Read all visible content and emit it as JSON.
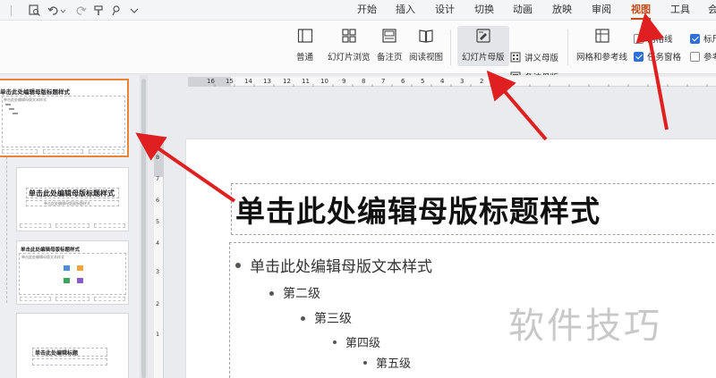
{
  "tabs": [
    {
      "label": "开始",
      "active": false
    },
    {
      "label": "插入",
      "active": false
    },
    {
      "label": "设计",
      "active": false
    },
    {
      "label": "切换",
      "active": false
    },
    {
      "label": "动画",
      "active": false
    },
    {
      "label": "放映",
      "active": false
    },
    {
      "label": "审阅",
      "active": false
    },
    {
      "label": "视图",
      "active": true
    },
    {
      "label": "工具",
      "active": false
    },
    {
      "label": "会",
      "active": false
    }
  ],
  "ribbon": {
    "normal": "普通",
    "slide_sorter": "幻灯片浏览",
    "notes_page": "备注页",
    "reading_view": "阅读视图",
    "slide_master": "幻灯片母版",
    "handout_master": "讲义母版",
    "notes_master": "备注母版",
    "grid_guides": "网格和参考线",
    "gridlines": "网格线",
    "task_pane": "任务窗格",
    "ruler": "标尺",
    "guides": "参考"
  },
  "thumbnails": {
    "t1_title": "单击此处编辑母版标题样式",
    "t1_body": "单击此处编辑母版文本样式",
    "t2_title": "单击此处编辑母版标题样式",
    "t2_sub": "单击此处编辑母版副标题样式",
    "t3_title": "单击此处编辑母版标题样式",
    "t3_body": "单击此处编辑母版文本样式",
    "t4_title": "单击此处编辑标题"
  },
  "ruler": {
    "h_ticks": [
      "16",
      "15",
      "14",
      "13",
      "12",
      "11",
      "10",
      "9",
      "8",
      "7",
      "6",
      "5",
      "4",
      "3",
      "2",
      "1"
    ],
    "v_ticks": [
      "8",
      "7",
      "6",
      "5",
      "4",
      "3",
      "2",
      "1"
    ]
  },
  "slide": {
    "title": "单击此处编辑母版标题样式",
    "level1": "单击此处编辑母版文本样式",
    "level2": "第二级",
    "level3": "第三级",
    "level4": "第四级",
    "level5": "第五级"
  },
  "watermark": "软件技巧",
  "colors": {
    "accent": "#c84b11",
    "selection": "#e8833a",
    "arrow": "#e02020",
    "check": "#2f6fd6"
  }
}
